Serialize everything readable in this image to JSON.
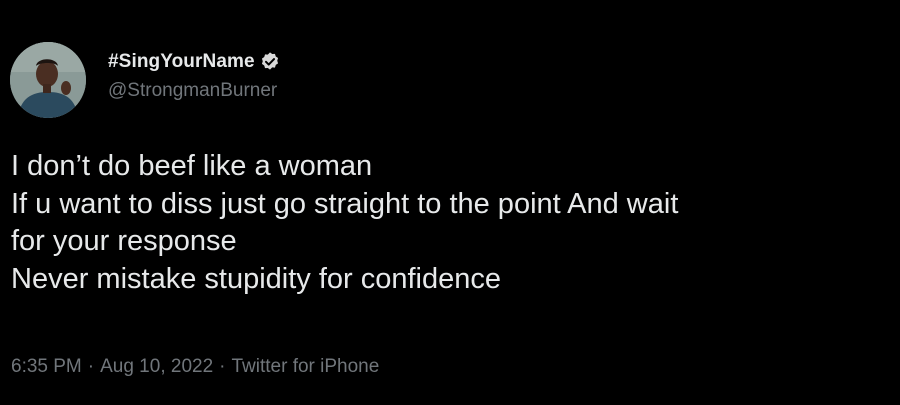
{
  "author": {
    "display_name": "#SingYourName",
    "handle": "@StrongmanBurner",
    "verified": true
  },
  "tweet": {
    "lines": [
      "I don’t do beef like a woman",
      "If u want to diss just go straight to the point And wait",
      "for your response",
      "Never mistake stupidity for confidence"
    ]
  },
  "meta": {
    "time": "6:35 PM",
    "separator": "·",
    "date": "Aug 10, 2022",
    "source": "Twitter for iPhone"
  },
  "colors": {
    "background": "#000000",
    "text": "#e7e9ea",
    "secondary": "#71767b",
    "verified_badge": "#d9d9d9"
  }
}
